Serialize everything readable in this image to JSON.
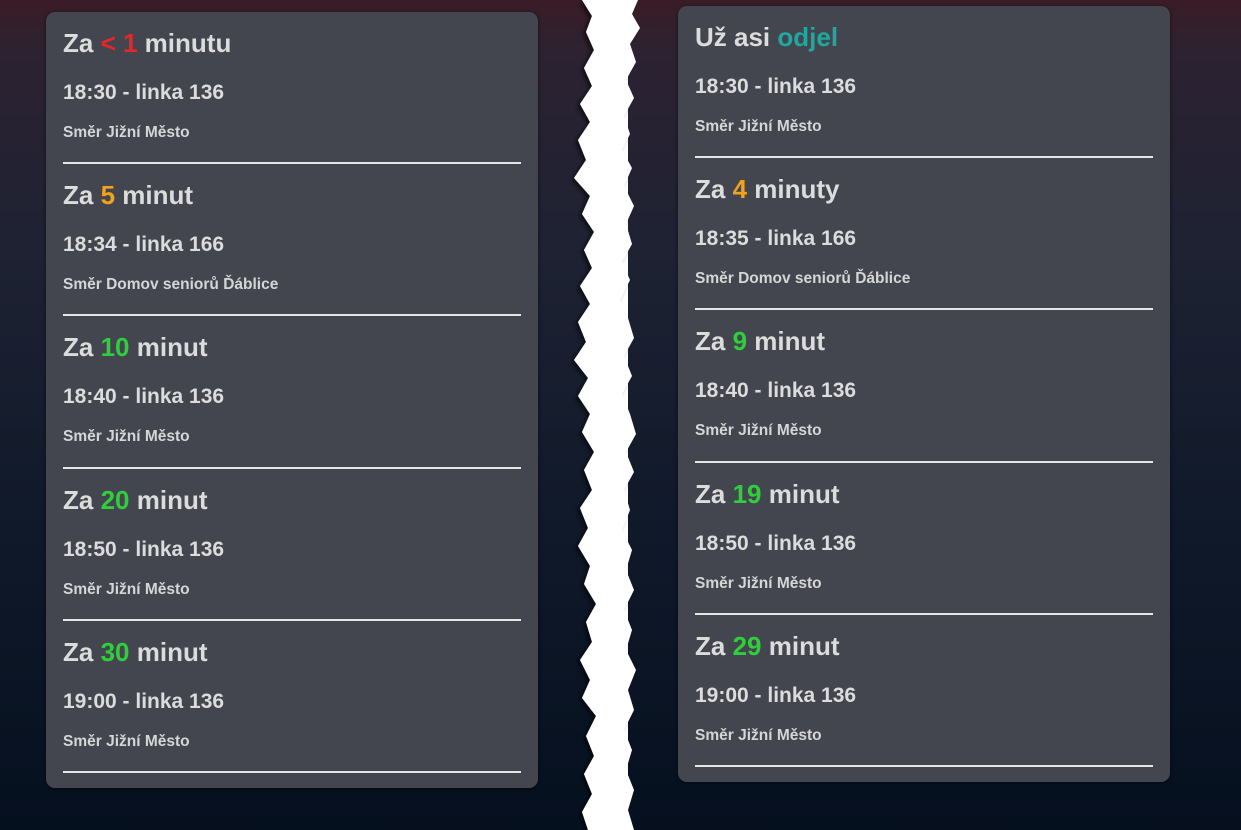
{
  "colors": {
    "red": "#e8262a",
    "orange": "#f3a21b",
    "green": "#2fcf3c",
    "teal": "#1fa8a0",
    "text": "#dcdcdc",
    "card": "#43464e"
  },
  "left_panel": {
    "entries": [
      {
        "prefix": "Za ",
        "value": "< 1",
        "value_color": "red",
        "suffix": " minutu",
        "time_line": "18:30 - linka 136",
        "direction": "Směr Jižní Město"
      },
      {
        "prefix": "Za ",
        "value": "5",
        "value_color": "orange",
        "suffix": " minut",
        "time_line": "18:34 - linka 166",
        "direction": "Směr Domov seniorů Ďáblice"
      },
      {
        "prefix": "Za ",
        "value": "10",
        "value_color": "green",
        "suffix": " minut",
        "time_line": "18:40 - linka 136",
        "direction": "Směr Jižní Město"
      },
      {
        "prefix": "Za ",
        "value": "20",
        "value_color": "green",
        "suffix": " minut",
        "time_line": "18:50 - linka 136",
        "direction": "Směr Jižní Město"
      },
      {
        "prefix": "Za ",
        "value": "30",
        "value_color": "green",
        "suffix": " minut",
        "time_line": "19:00 - linka 136",
        "direction": "Směr Jižní Město"
      }
    ]
  },
  "right_panel": {
    "entries": [
      {
        "prefix": "Už asi ",
        "value": "odjel",
        "value_color": "teal",
        "suffix": "",
        "time_line": "18:30 - linka 136",
        "direction": "Směr Jižní Město"
      },
      {
        "prefix": "Za ",
        "value": "4",
        "value_color": "orange",
        "suffix": " minuty",
        "time_line": "18:35 - linka 166",
        "direction": "Směr Domov seniorů Ďáblice"
      },
      {
        "prefix": "Za ",
        "value": "9",
        "value_color": "green",
        "suffix": " minut",
        "time_line": "18:40 - linka 136",
        "direction": "Směr Jižní Město"
      },
      {
        "prefix": "Za ",
        "value": "19",
        "value_color": "green",
        "suffix": " minut",
        "time_line": "18:50 - linka 136",
        "direction": "Směr Jižní Město"
      },
      {
        "prefix": "Za ",
        "value": "29",
        "value_color": "green",
        "suffix": " minut",
        "time_line": "19:00 - linka 136",
        "direction": "Směr Jižní Město"
      }
    ]
  }
}
